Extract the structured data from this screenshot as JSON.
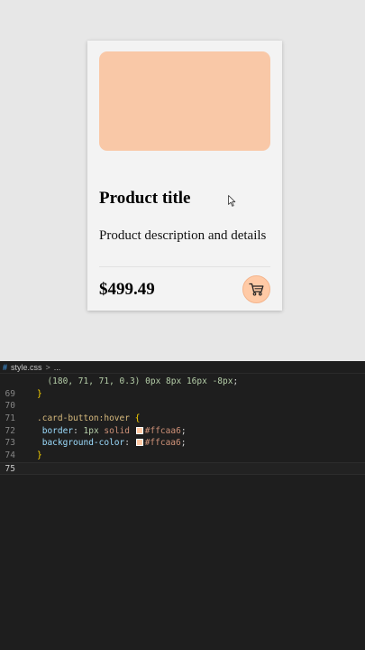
{
  "preview": {
    "card": {
      "image_color": "#f9c8a7",
      "title": "Product title",
      "description": "Product description and details",
      "price": "$499.49",
      "button_color": "#ffcaa6",
      "button_border_color": "#f4b48c",
      "button_icon": "shopping-cart-icon"
    }
  },
  "editor": {
    "breadcrumb": {
      "file_icon": "css-hash-icon",
      "file": "style.css",
      "separator": ">",
      "rest": "..."
    },
    "lines": [
      {
        "number": "",
        "parts": [
          [
            "num",
            "(180, 71, 71, 0.3)"
          ],
          [
            "punc",
            " "
          ],
          [
            "num",
            "0px"
          ],
          [
            "punc",
            " "
          ],
          [
            "num",
            "8px"
          ],
          [
            "punc",
            " "
          ],
          [
            "num",
            "16px"
          ],
          [
            "punc",
            " "
          ],
          [
            "num",
            "-8px"
          ],
          [
            "punc",
            ";"
          ]
        ],
        "indent": "  "
      },
      {
        "number": "69",
        "parts": [
          [
            "brace",
            "}"
          ]
        ],
        "indent": ""
      },
      {
        "number": "70",
        "parts": [],
        "indent": ""
      },
      {
        "number": "71",
        "parts": [
          [
            "sel",
            ".card-button:hover"
          ],
          [
            "punc",
            " "
          ],
          [
            "brace",
            "{"
          ]
        ],
        "indent": ""
      },
      {
        "number": "72",
        "parts": [
          [
            "prop",
            "border"
          ],
          [
            "punc",
            ": "
          ],
          [
            "num",
            "1px"
          ],
          [
            "punc",
            " "
          ],
          [
            "val",
            "solid"
          ],
          [
            "punc",
            " "
          ],
          [
            "swatch",
            "#ffcaa6"
          ],
          [
            "val",
            "#ffcaa6"
          ],
          [
            "punc",
            ";"
          ]
        ],
        "indent": " "
      },
      {
        "number": "73",
        "parts": [
          [
            "prop",
            "background-color"
          ],
          [
            "punc",
            ": "
          ],
          [
            "swatch",
            "#ffcaa6"
          ],
          [
            "val",
            "#ffcaa6"
          ],
          [
            "punc",
            ";"
          ]
        ],
        "indent": " "
      },
      {
        "number": "74",
        "parts": [
          [
            "brace",
            "}"
          ]
        ],
        "indent": ""
      },
      {
        "number": "75",
        "parts": [],
        "indent": "",
        "current": true
      }
    ]
  },
  "colors": {
    "preview_bg": "#e7e7e7",
    "card_bg": "#f3f3f3",
    "editor_bg": "#1e1e1e"
  }
}
